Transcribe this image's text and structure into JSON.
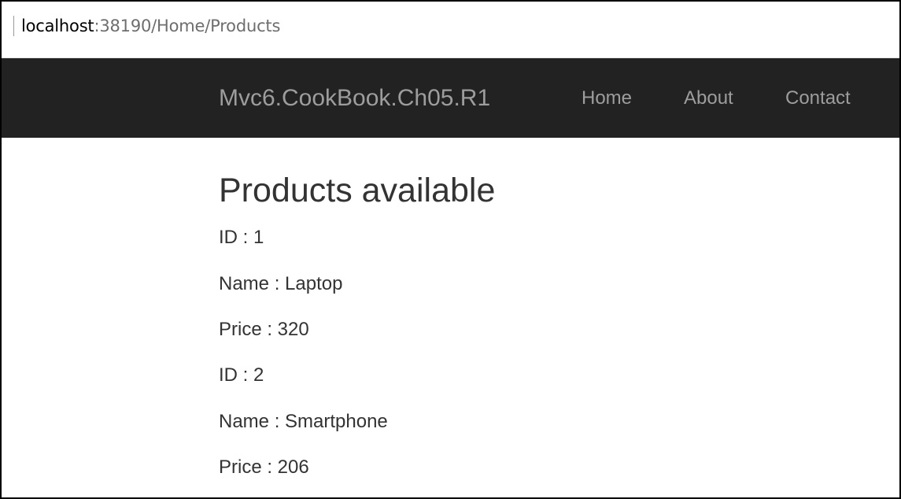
{
  "browser": {
    "url_host": "localhost",
    "url_rest": ":38190/Home/Products"
  },
  "navbar": {
    "brand": "Mvc6.CookBook.Ch05.R1",
    "links": [
      "Home",
      "About",
      "Contact"
    ],
    "background_color": "#222222",
    "link_color": "#9d9d9d"
  },
  "main": {
    "title": "Products available",
    "products": [
      {
        "id_line": "ID : 1",
        "name_line": "Name : Laptop",
        "price_line": "Price : 320"
      },
      {
        "id_line": "ID : 2",
        "name_line": "Name : Smartphone",
        "price_line": "Price : 206"
      }
    ]
  }
}
